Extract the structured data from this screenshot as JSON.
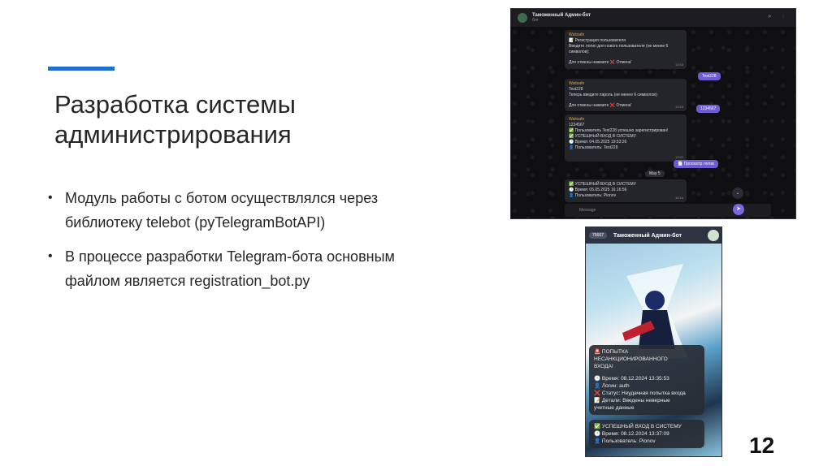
{
  "slide": {
    "title": "Разработка системы администрирования",
    "bullets": [
      "Модуль работы с ботом осуществлялся через библиотеку telebot (pyTelegramBotAPI)",
      "В процессе разработки Telegram-бота основным файлом является registration_bot.py"
    ],
    "page_number": "12",
    "accent_color": "#1f6fd1"
  },
  "desktop_chat": {
    "header_title": "Таможенный Админ-бот",
    "header_subtitle": "бот",
    "messages": [
      {
        "from": "Waitsafe",
        "lines": [
          "📝 Регистрация пользователя",
          "Введите логин для нового пользователя (не менее 6 символов):",
          "",
          "Для отмены нажмите ❌ Отмена'"
        ],
        "time": "13:53"
      },
      {
        "from": "Waitsafe",
        "lines": [
          "Test228",
          "Теперь введите пароль (не менее 6 символов):",
          "",
          "Для отмены нажмите ❌ Отмена'"
        ],
        "time": "13:53"
      },
      {
        "from": "Waitsafe",
        "lines": [
          "1234567",
          "✅ Пользователь Test228 успешно зарегистрирован!",
          "✅ УСПЕШНЫЙ ВХОД В СИСТЕМУ",
          "",
          "🕐 Время: 04.05.2025 19:53:26",
          "👤 Пользователь: Test228"
        ],
        "time": "13:53"
      },
      {
        "from": "",
        "lines": [
          "✅ УСПЕШНЫЙ ВХОД В СИСТЕМУ",
          "",
          "🕐 Время: 05.05.2025 16:16:56",
          "👤 Пользователь: Pionov"
        ],
        "time": "16:16"
      }
    ],
    "outgoing": [
      "Test228",
      "1234567",
      "📄 Просмотр логов"
    ],
    "date_chip": "May 5",
    "input_placeholder": "Message"
  },
  "mobile_chat": {
    "back_badge": "75667",
    "header_title": "Таможенный Админ-бот",
    "alert_lines": [
      "🚨 ПОПЫТКА",
      "НЕСАНКЦИОНИРОВАННОГО",
      "ВХОДА!",
      "",
      "🕐 Время: 08.12.2024 13:35:53",
      "👤 Логин: auth",
      "❌ Статус: Неудачная попытка входа",
      "📝 Детали: Введены неверные",
      "учетные данные"
    ],
    "success_lines": [
      "✅ УСПЕШНЫЙ ВХОД В СИСТЕМУ",
      "",
      "🕐 Время: 08.12.2024 13:37:09",
      "👤 Пользователь: Pionov"
    ]
  }
}
